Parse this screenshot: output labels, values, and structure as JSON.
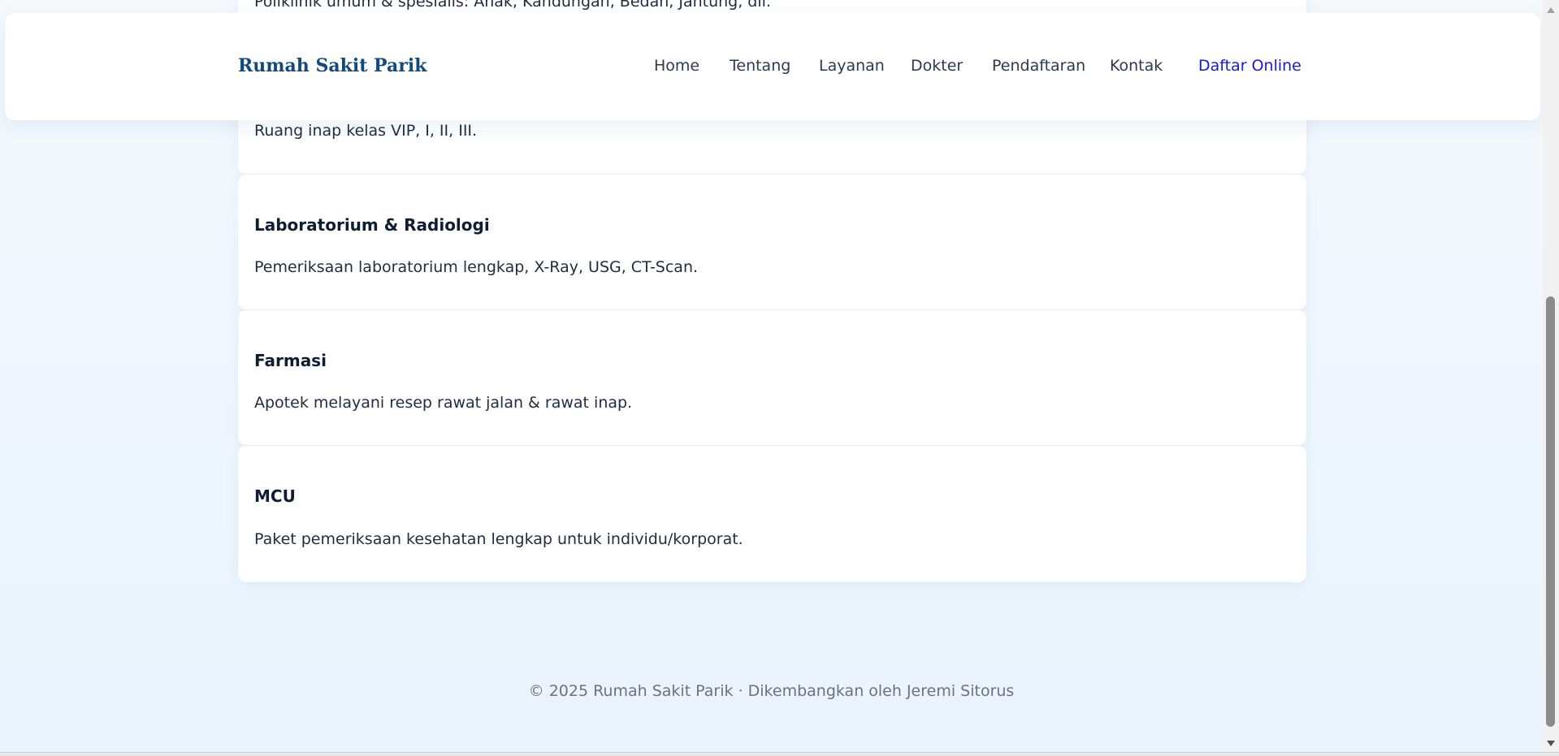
{
  "header": {
    "brand": "Rumah Sakit Parik",
    "nav": [
      {
        "label": "Home"
      },
      {
        "label": "Tentang"
      },
      {
        "label": "Layanan"
      },
      {
        "label": "Dokter"
      },
      {
        "label": "Pendaftaran"
      },
      {
        "label": "Kontak"
      }
    ],
    "cta_label": "Daftar Online"
  },
  "services": [
    {
      "title": "",
      "description": "Poliklinik umum & spesialis: Anak, Kandungan, Bedah, Jantung, dll."
    },
    {
      "title": "",
      "description": "Ruang inap kelas VIP, I, II, III."
    },
    {
      "title": "Laboratorium & Radiologi",
      "description": "Pemeriksaan laboratorium lengkap, X-Ray, USG, CT-Scan."
    },
    {
      "title": "Farmasi",
      "description": "Apotek melayani resep rawat jalan & rawat inap."
    },
    {
      "title": "MCU",
      "description": "Paket pemeriksaan kesehatan lengkap untuk individu/korporat."
    }
  ],
  "footer": {
    "text": "© 2025 Rumah Sakit Parik · Dikembangkan oleh Jeremi Sitorus"
  }
}
